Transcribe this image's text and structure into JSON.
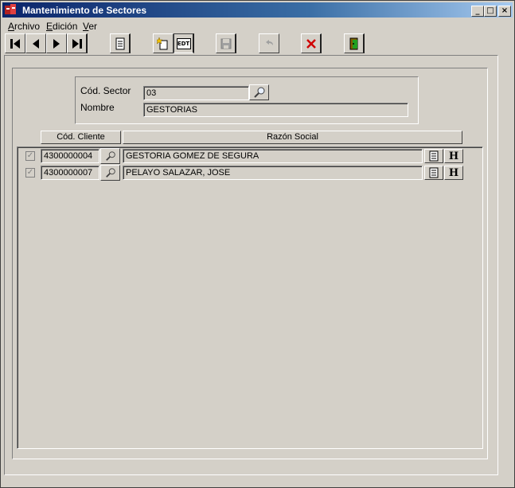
{
  "window": {
    "title": "Mantenimiento de Sectores",
    "minimize_glyph": "_",
    "maximize_glyph": "□",
    "close_glyph": "×"
  },
  "menu": {
    "items": [
      {
        "label_first": "A",
        "label_rest": "rchivo"
      },
      {
        "label_first": "E",
        "label_rest": "dición"
      },
      {
        "label_first": "V",
        "label_rest": "er"
      }
    ]
  },
  "toolbar": {
    "buttons": [
      "first-record",
      "previous-record",
      "next-record",
      "last-record",
      "list-view",
      "new-record",
      "edit-record",
      "save-record",
      "undo",
      "delete-record",
      "exit"
    ],
    "edit_label": "EDT"
  },
  "header": {
    "codigo_label": "Cód. Sector",
    "codigo_value": "03",
    "nombre_label": "Nombre",
    "nombre_value": "GESTORIAS"
  },
  "grid": {
    "columns": [
      "Cód. Cliente",
      "Razón Social"
    ],
    "rows": [
      {
        "checked": true,
        "codigo": "4300000004",
        "razon": "GESTORIA GOMEZ DE SEGURA"
      },
      {
        "checked": true,
        "codigo": "4300000007",
        "razon": "PELAYO SALAZAR, JOSE"
      }
    ],
    "history_label": "H",
    "check_glyph": "✓"
  }
}
